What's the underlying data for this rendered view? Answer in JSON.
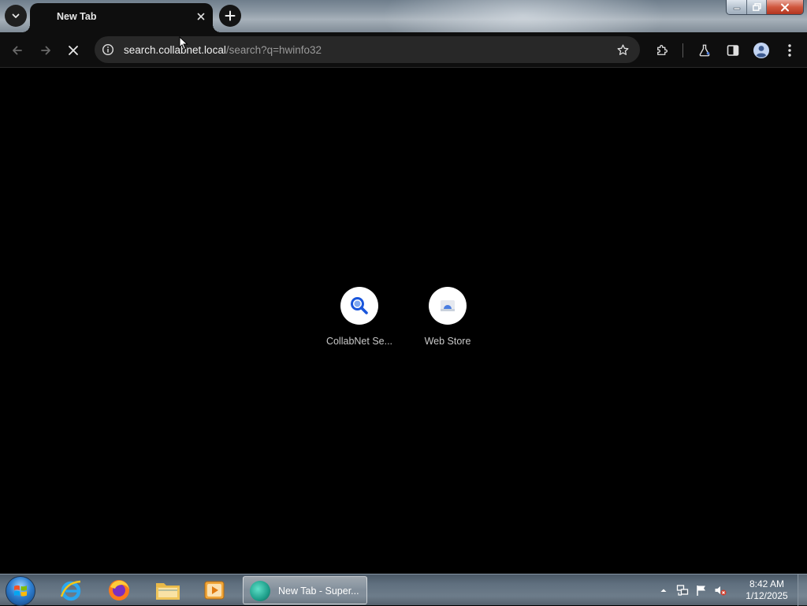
{
  "tabstrip": {
    "tab_search_icon": "chevron-down-icon",
    "tab": {
      "title": "New Tab",
      "close_icon": "close-icon"
    },
    "new_tab_icon": "plus-icon",
    "window_controls": [
      "minimize-icon",
      "restore-icon",
      "close-icon"
    ]
  },
  "toolbar": {
    "back_icon": "arrow-left-icon",
    "forward_icon": "arrow-right-icon",
    "stop_icon": "close-icon",
    "omnibox": {
      "info_icon": "info-icon",
      "host": "search.collabnet.local",
      "path": "/search?q=hwinfo32",
      "star_icon": "star-icon"
    },
    "extensions_icon": "puzzle-icon",
    "labs_icon": "flask-icon",
    "side_panel_icon": "side-panel-icon",
    "profile_icon": "person-icon",
    "menu_icon": "kebab-menu-icon"
  },
  "content": {
    "shortcuts": [
      {
        "label": "CollabNet Se...",
        "icon": "search-icon"
      },
      {
        "label": "Web Store",
        "icon": "web-store-icon"
      }
    ]
  },
  "taskbar": {
    "pinned": [
      "internet-explorer-icon",
      "firefox-icon",
      "file-explorer-icon",
      "media-player-icon"
    ],
    "active_task": {
      "label": "New Tab - Super...",
      "icon": "browser-icon"
    },
    "tray": {
      "icons": [
        "show-hidden-icons-icon",
        "network-icon",
        "action-center-flag-icon",
        "speaker-muted-icon"
      ],
      "time": "8:42 AM",
      "date": "1/12/2025"
    }
  },
  "colors": {
    "page_background": "#000000",
    "toolbar_background": "#0e0e0e",
    "omnibox_background": "#282828",
    "shortcut_circle": "#ffffff",
    "search_icon_blue": "#1a56db"
  }
}
